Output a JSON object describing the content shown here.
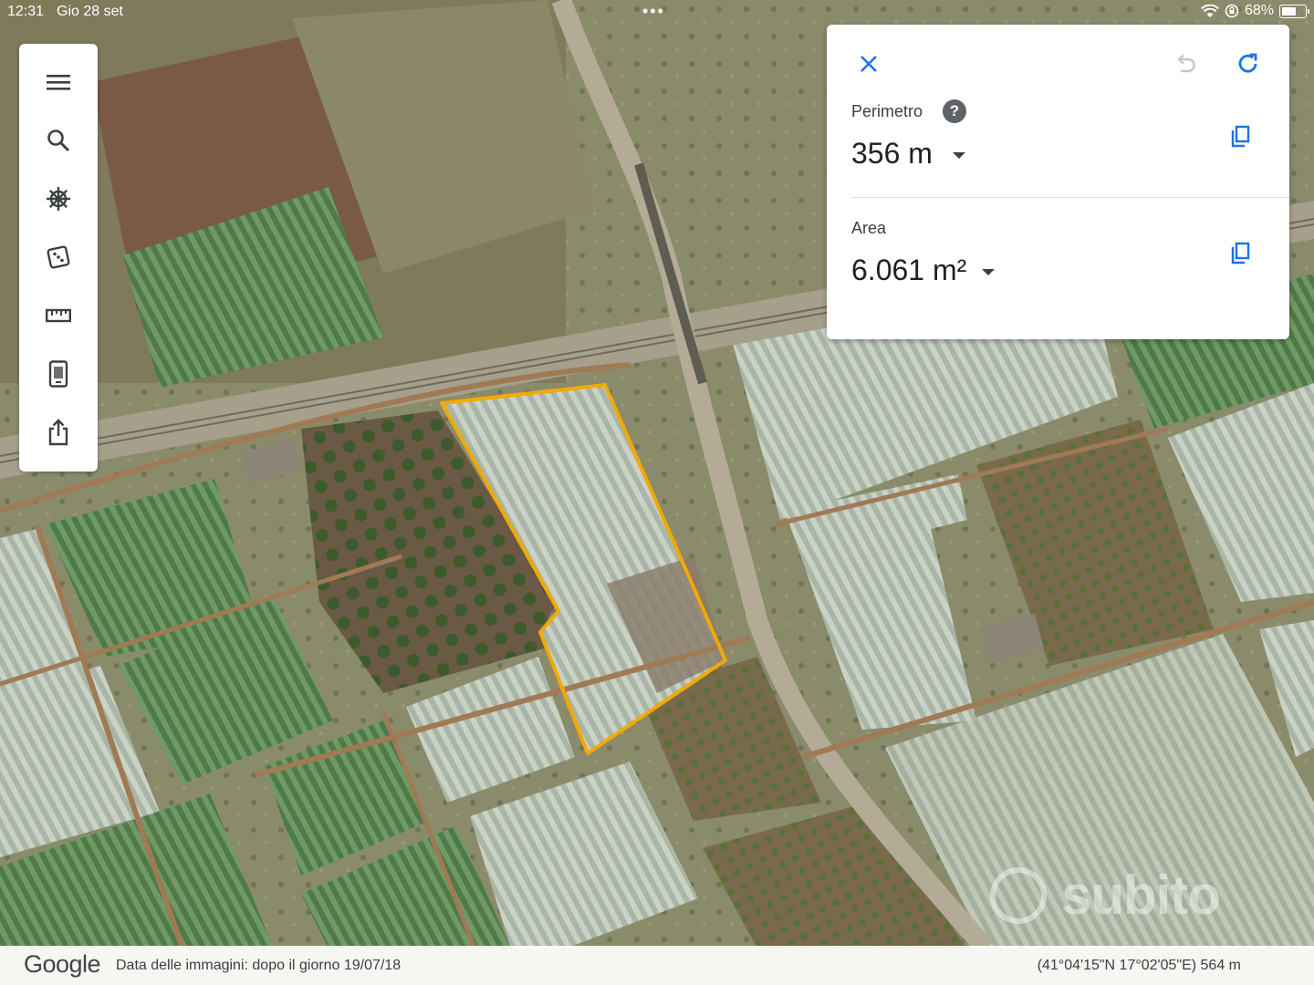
{
  "status_bar": {
    "time": "12:31",
    "date": "Gio 28 set",
    "multitask_dots": "•••",
    "battery": "68%",
    "battery_level": 0.68
  },
  "toolbar": {
    "items": [
      {
        "name": "menu-icon"
      },
      {
        "name": "search-icon"
      },
      {
        "name": "voyager-wheel-icon"
      },
      {
        "name": "feeling-lucky-dice-icon"
      },
      {
        "name": "ruler-icon"
      },
      {
        "name": "projects-icon"
      },
      {
        "name": "share-icon"
      }
    ]
  },
  "measure_panel": {
    "perimeter_label": "Perimetro",
    "perimeter_help": "?",
    "perimeter_value": "356 m",
    "area_label": "Area",
    "area_value": "6.061 m²",
    "accent_color": "#1a73e8"
  },
  "bottom_bar": {
    "logo": "Google",
    "imagery_date": "Data delle immagini: dopo il giorno 19/07/18",
    "coordinates": "(41°04'15\"N 17°02'05\"E) 564 m"
  },
  "watermark": {
    "text": "subito"
  },
  "map": {
    "polygon_color": "#f2a900"
  }
}
